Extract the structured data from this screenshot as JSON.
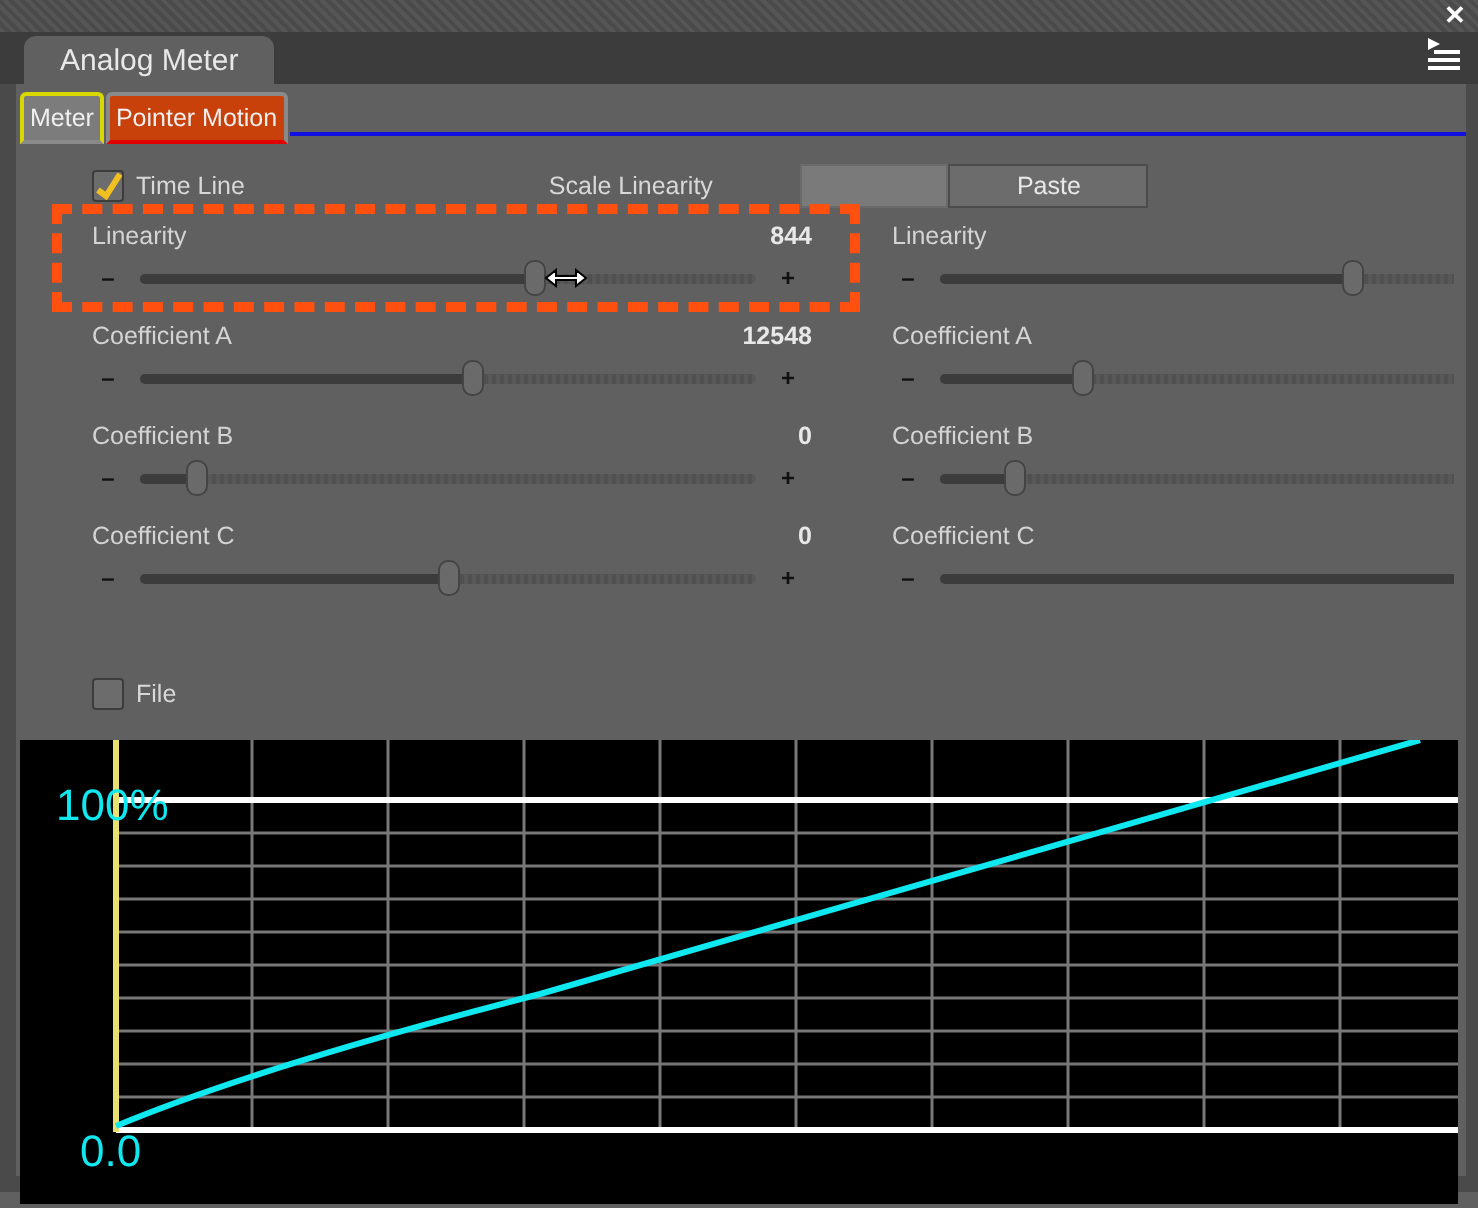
{
  "panel": {
    "title": "Analog Meter",
    "close": "✕"
  },
  "tabs": [
    {
      "label": "Meter",
      "selected": false,
      "focused": true
    },
    {
      "label": "Pointer Motion",
      "selected": true,
      "focused": false
    }
  ],
  "time_line": {
    "label": "Time Line",
    "checked": true
  },
  "scale_linearity": {
    "label": "Scale Linearity",
    "paste": "Paste"
  },
  "left_sliders": [
    {
      "name": "Linearity",
      "reading": "844",
      "level": 0.64
    },
    {
      "name": "Coefficient A",
      "reading": "12548",
      "level": 0.54
    },
    {
      "name": "Coefficient B",
      "reading": "0",
      "level": 0.09
    },
    {
      "name": "Coefficient C",
      "reading": "0",
      "level": 0.5
    }
  ],
  "right_sliders": [
    {
      "name": "Linearity",
      "level": 0.67
    },
    {
      "name": "Coefficient A",
      "level": 0.23
    },
    {
      "name": "Coefficient B",
      "level": 0.12
    },
    {
      "name": "Coefficient C",
      "level": 0.95
    }
  ],
  "slider_signs": {
    "minus": "–",
    "plus": "+"
  },
  "file": {
    "label": "File",
    "checked": false
  },
  "graph": {
    "top_label": "100%",
    "bottom_label": "0.0"
  }
}
